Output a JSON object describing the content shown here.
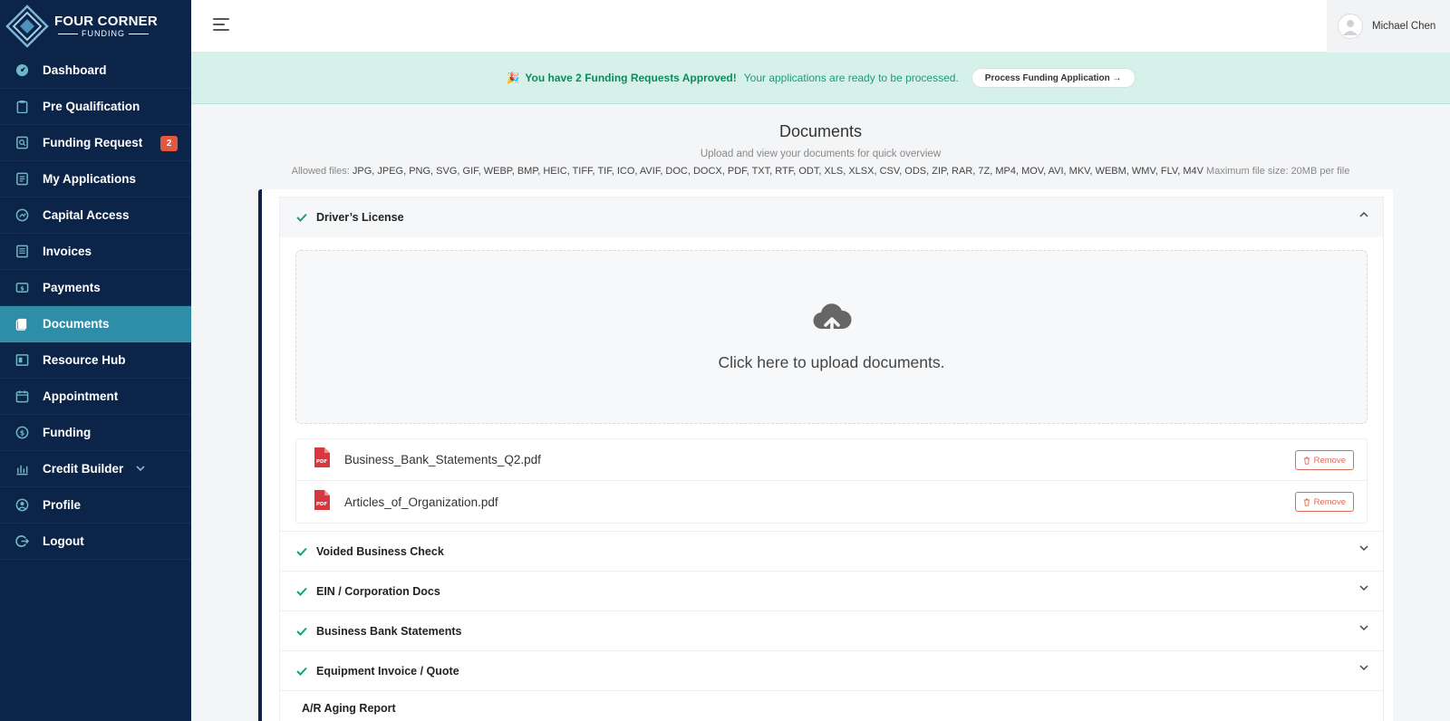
{
  "brand": {
    "title": "FOUR CORNER",
    "subtitle": "FUNDING"
  },
  "sidebar": {
    "items": [
      {
        "label": "Dashboard",
        "icon": "dashboard-icon"
      },
      {
        "label": "Pre Qualification",
        "icon": "clipboard-icon"
      },
      {
        "label": "Funding Request",
        "icon": "request-icon",
        "badge": "2"
      },
      {
        "label": "My Applications",
        "icon": "applications-icon"
      },
      {
        "label": "Capital Access",
        "icon": "gauge-icon"
      },
      {
        "label": "Invoices",
        "icon": "invoice-icon"
      },
      {
        "label": "Payments",
        "icon": "payment-icon"
      },
      {
        "label": "Documents",
        "icon": "documents-icon",
        "active": true
      },
      {
        "label": "Resource Hub",
        "icon": "resource-icon"
      },
      {
        "label": "Appointment",
        "icon": "calendar-icon"
      },
      {
        "label": "Funding",
        "icon": "dollar-icon"
      },
      {
        "label": "Credit Builder",
        "icon": "bank-icon"
      },
      {
        "label": "Profile",
        "icon": "profile-icon"
      },
      {
        "label": "Logout",
        "icon": "logout-icon"
      }
    ],
    "active_color": "#2e8ea8",
    "bg_color": "#0b2447"
  },
  "user": {
    "name": "Michael Chen"
  },
  "banner": {
    "emoji": "🎉",
    "headline": "You have 2 Funding Requests Approved!",
    "text": "Your applications are ready to be processed.",
    "button": "Process Funding Application →"
  },
  "page": {
    "title": "Documents",
    "subtitle": "Upload and view your documents for quick overview",
    "allowed_prefix": "Allowed files:",
    "allowed_types": "JPG, JPEG, PNG, SVG, GIF, WEBP, BMP, HEIC, TIFF, TIF, ICO, AVIF, DOC, DOCX, PDF, TXT, RTF, ODT, XLS, XLSX, CSV, ODS, ZIP, RAR, 7Z, MP4, MOV, AVI, MKV, WEBM, WMV, FLV, M4V",
    "max_size": "Maximum file size: 20MB per file"
  },
  "sections": [
    {
      "title": "Driver’s License"
    },
    {
      "title": "Voided Business Check"
    },
    {
      "title": "EIN / Corporation Docs"
    },
    {
      "title": "Business Bank Statements"
    },
    {
      "title": "Equipment Invoice / Quote"
    },
    {
      "title": "A/R Aging Report"
    }
  ],
  "upload": {
    "prompt": "Click here to upload documents."
  },
  "files": [
    {
      "name": "Business_Bank_Statements_Q2.pdf",
      "remove_label": "Remove",
      "icon_label": "PDF"
    },
    {
      "name": "Articles_of_Organization.pdf",
      "remove_label": "Remove",
      "icon_label": "PDF"
    }
  ]
}
